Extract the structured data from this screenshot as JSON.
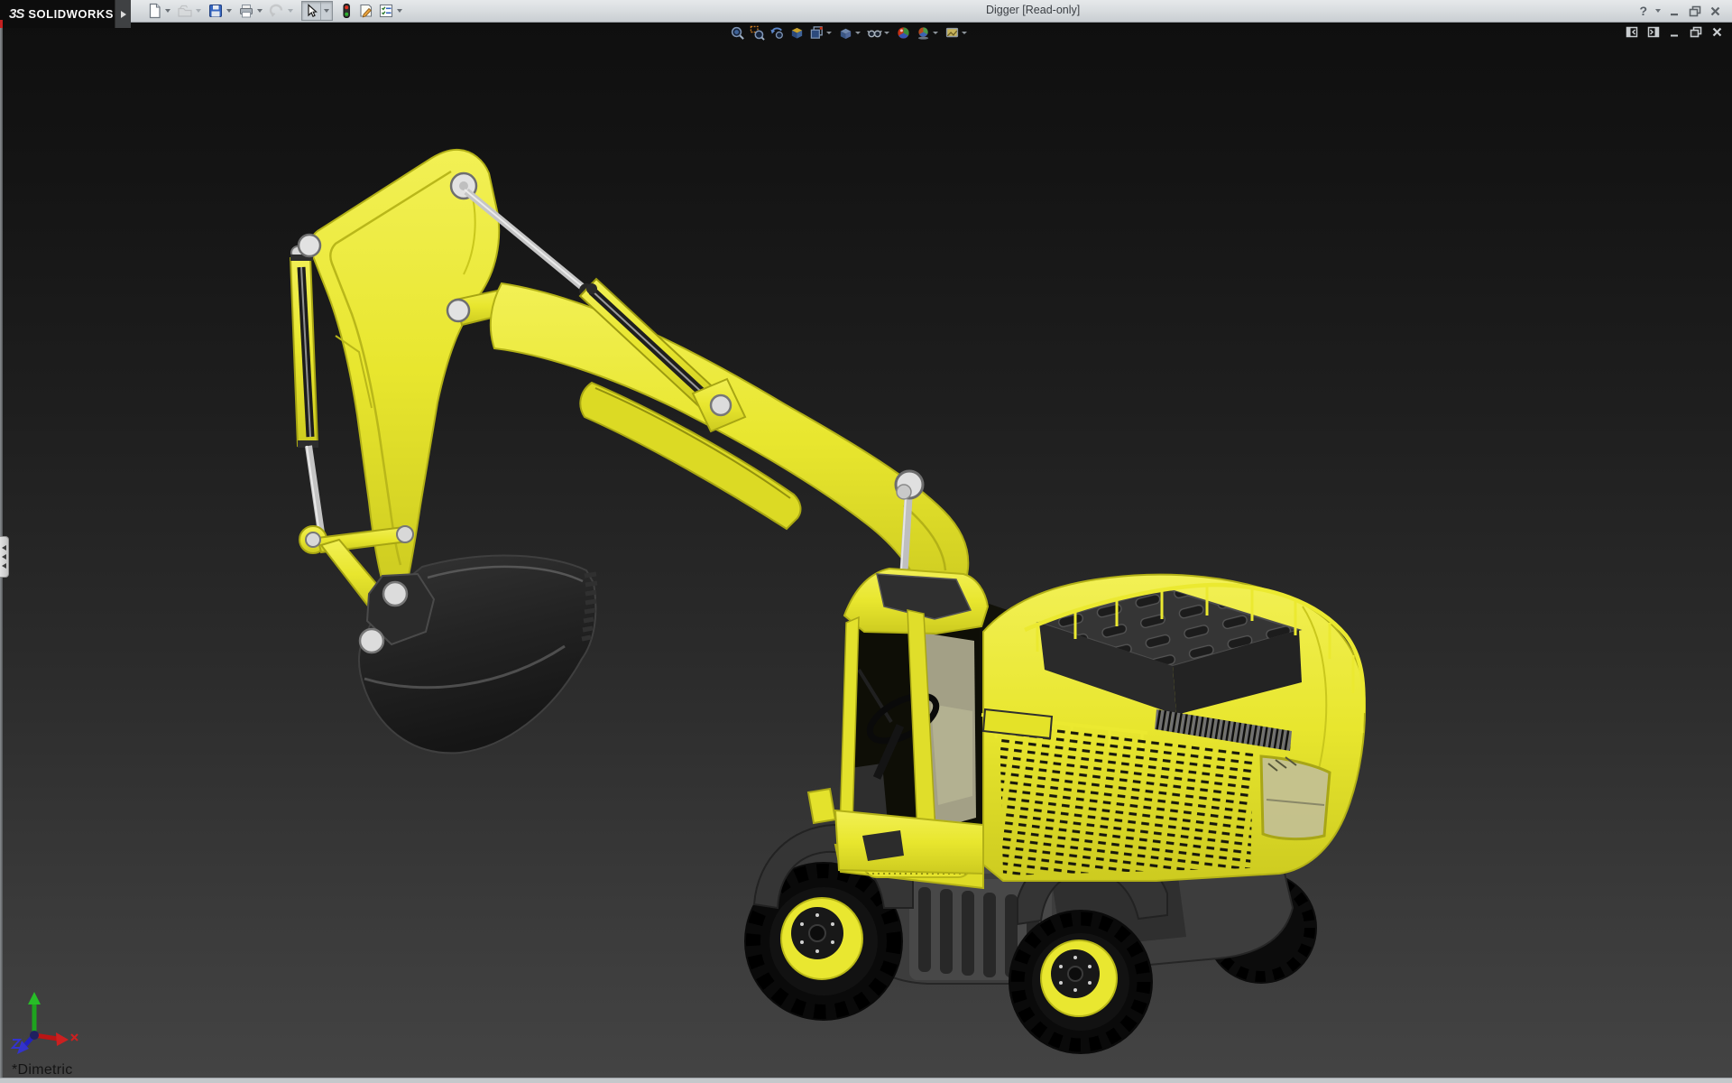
{
  "titlebar": {
    "brand_mark": "3S",
    "brand": "SOLIDWORKS",
    "title": "Digger [Read-only]",
    "help_glyph": "?",
    "toolbar": {
      "items": [
        {
          "name": "new-document",
          "dropdown": true,
          "disabled": false
        },
        {
          "name": "open-document",
          "dropdown": true,
          "disabled": true
        },
        {
          "name": "save",
          "dropdown": true,
          "disabled": false
        },
        {
          "name": "print",
          "dropdown": true,
          "disabled": false
        },
        {
          "name": "undo",
          "dropdown": true,
          "disabled": true
        },
        {
          "name": "select",
          "dropdown": true,
          "disabled": false,
          "pressed": true
        },
        {
          "name": "interference-traffic-light",
          "dropdown": false,
          "disabled": false
        },
        {
          "name": "rebuild",
          "dropdown": false,
          "disabled": false
        },
        {
          "name": "options",
          "dropdown": true,
          "disabled": false
        }
      ]
    },
    "window_controls": [
      "help",
      "minimize",
      "restore",
      "close"
    ]
  },
  "viewport": {
    "headsup_toolbar": {
      "items": [
        {
          "name": "zoom-to-fit",
          "dropdown": false
        },
        {
          "name": "zoom-to-area",
          "dropdown": false
        },
        {
          "name": "previous-view",
          "dropdown": false
        },
        {
          "name": "section-view",
          "dropdown": false
        },
        {
          "name": "view-orientation",
          "dropdown": true
        },
        {
          "name": "display-style",
          "dropdown": true
        },
        {
          "name": "hide-show-items",
          "dropdown": true
        },
        {
          "name": "edit-appearance",
          "dropdown": false
        },
        {
          "name": "apply-scene",
          "dropdown": true
        },
        {
          "name": "view-settings",
          "dropdown": true
        }
      ]
    },
    "child_window_controls": [
      "toggle-left-pane",
      "toggle-right-pane",
      "minimize-document",
      "restore-document",
      "close-document"
    ],
    "view_label": "*Dimetric",
    "background_top": "#0f0f0f",
    "background_bottom": "#444444",
    "collapsed_left_panel": true
  },
  "model": {
    "name": "Digger",
    "body_color": "#e8e62e",
    "dark_parts_color": "#2b2b2b",
    "pin_color": "#dcdcdc",
    "rod_color": "#c4c4c4",
    "tire_color": "#0b0b0b",
    "glass_tint": "#c9c6a6"
  },
  "triad": {
    "x_axis_color": "#cc2020",
    "y_axis_color": "#27bd27",
    "z_axis_color": "#3333cc"
  }
}
